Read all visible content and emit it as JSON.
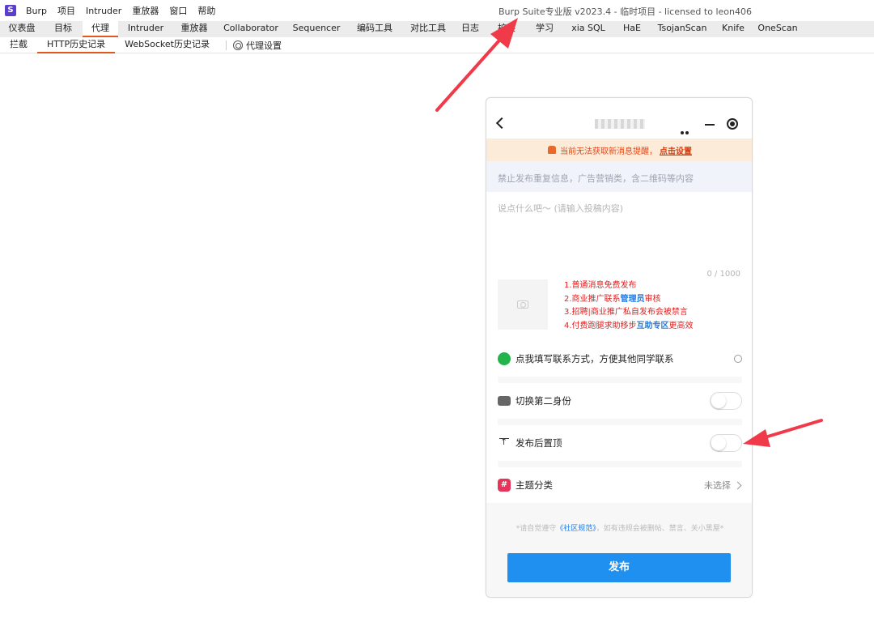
{
  "menubar": {
    "logo": "S",
    "items": [
      "Burp",
      "项目",
      "Intruder",
      "重放器",
      "窗口",
      "帮助"
    ],
    "window_title": "Burp Suite专业版  v2023.4 - 临时项目 - licensed to leon406"
  },
  "main_tabs": [
    "仪表盘",
    "目标",
    "代理",
    "Intruder",
    "重放器",
    "Collaborator",
    "Sequencer",
    "编码工具",
    "对比工具",
    "日志",
    "扩展",
    "学习",
    "xia SQL",
    "HaE",
    "TsojanScan",
    "Knife",
    "OneScan"
  ],
  "active_main_tab": "代理",
  "sub_tabs": {
    "intercept": "拦截",
    "http_history": "HTTP历史记录",
    "websocket_history": "WebSocket历史记录",
    "proxy_settings": "代理设置"
  },
  "phone": {
    "notice": {
      "text": "当前无法获取新消息提醒，",
      "link": "点击设置"
    },
    "rule_hint": "禁止发布重复信息，广告营销类，含二维码等内容",
    "post_placeholder": "说点什么吧～ (请输入投稿内容)",
    "char_count": "0 / 1000",
    "rules": {
      "r1": "1.普通消息免费发布",
      "r2_pre": "2.商业推广联系",
      "r2_hl": "管理员",
      "r2_post": "审核",
      "r3": "3.招聘|商业推广私自发布会被禁言",
      "r4_pre": "4.付费跑腿求助移步",
      "r4_hl": "互助专区",
      "r4_post": "更高效"
    },
    "contact_row": "点我填写联系方式，方便其他同学联系",
    "second_identity": "切换第二身份",
    "pin_after_publish": "发布后置顶",
    "topic": {
      "label": "主题分类",
      "value": "未选择"
    },
    "disclaimer": {
      "pre": "*请自觉遵守",
      "link": "《社区规范》",
      "post": "，如有违规会被删帖、禁言、关小黑屋*"
    },
    "publish_label": "发布"
  },
  "colors": {
    "accent_tab": "#e3581c",
    "publish_button": "#1f8ff0",
    "rule_red": "#e02020",
    "highlight_blue": "#1e7be8",
    "annotation_arrow": "#f03a4a"
  }
}
